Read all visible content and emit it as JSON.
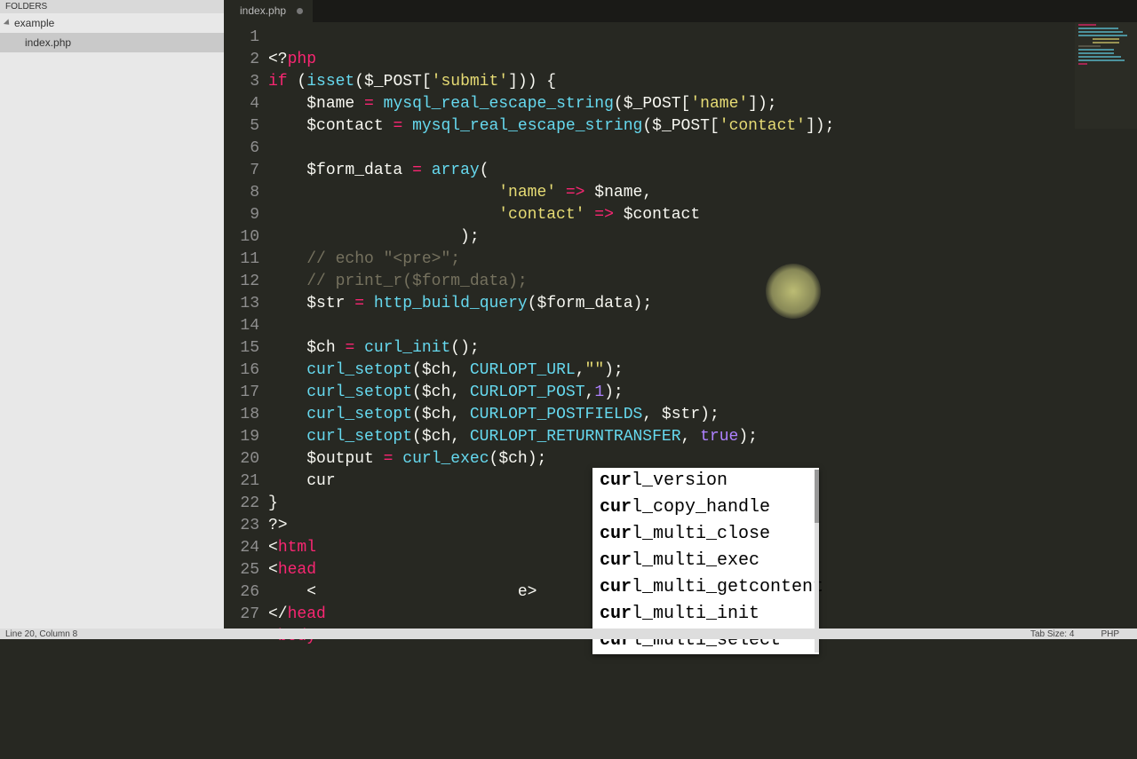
{
  "sidebar": {
    "header": "FOLDERS",
    "folder": "example",
    "file": "index.php"
  },
  "tab": {
    "label": "index.php"
  },
  "status": {
    "position": "Line 20, Column 8",
    "tabsize": "Tab Size: 4",
    "syntax": "PHP"
  },
  "code": {
    "l1": "<?php",
    "l2_if": "if",
    "l2_isset": "isset",
    "l2_post": "$_POST",
    "l2_key": "'submit'",
    "l3_var": "$name",
    "l3_fn": "mysql_real_escape_string",
    "l3_post": "$_POST",
    "l3_key": "'name'",
    "l4_var": "$contact",
    "l4_fn": "mysql_real_escape_string",
    "l4_post": "$_POST",
    "l4_key": "'contact'",
    "l6_var": "$form_data",
    "l6_fn": "array",
    "l7_key": "'name'",
    "l7_val": "$name",
    "l8_key": "'contact'",
    "l8_val": "$contact",
    "l10": "// echo \"<pre>\";",
    "l11": "// print_r($form_data);",
    "l12_var": "$str",
    "l12_fn": "http_build_query",
    "l12_arg": "$form_data",
    "l14_var": "$ch",
    "l14_fn": "curl_init",
    "l15_fn": "curl_setopt",
    "l15_ch": "$ch",
    "l15_c": "CURLOPT_URL",
    "l15_v": "\"\"",
    "l16_fn": "curl_setopt",
    "l16_ch": "$ch",
    "l16_c": "CURLOPT_POST",
    "l16_v": "1",
    "l17_fn": "curl_setopt",
    "l17_ch": "$ch",
    "l17_c": "CURLOPT_POSTFIELDS",
    "l17_v": "$str",
    "l18_fn": "curl_setopt",
    "l18_ch": "$ch",
    "l18_c": "CURLOPT_RETURNTRANSFER",
    "l18_v": "true",
    "l19_var": "$output",
    "l19_fn": "curl_exec",
    "l19_arg": "$ch",
    "l20": "cur",
    "l22": "?>",
    "l23": "html",
    "l24": "head",
    "l25a": "<",
    "l25b": "e>",
    "l26": "head",
    "l27": "body"
  },
  "autocomplete": {
    "prefix": "cur",
    "items": [
      "curl_version",
      "curl_copy_handle",
      "curl_multi_close",
      "curl_multi_exec",
      "curl_multi_getcontent",
      "curl_multi_init",
      "curl_multi_select"
    ]
  }
}
